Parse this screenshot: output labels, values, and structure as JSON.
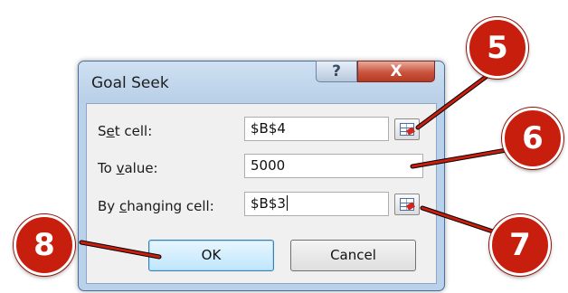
{
  "dialog": {
    "title": "Goal Seek",
    "help_glyph": "?",
    "close_glyph": "X"
  },
  "fields": {
    "set_cell": {
      "label_pre": "S",
      "label_accel": "e",
      "label_post": "t cell:",
      "value": "$B$4"
    },
    "to_value": {
      "label_pre": "To ",
      "label_accel": "v",
      "label_post": "alue:",
      "value": "5000"
    },
    "by_changing": {
      "label_pre": "By ",
      "label_accel": "c",
      "label_post": "hanging cell:",
      "value": "$B$3"
    }
  },
  "buttons": {
    "ok": "OK",
    "cancel": "Cancel"
  },
  "callouts": {
    "set_cell_ref": "5",
    "to_value_field": "6",
    "changing_cell_ref": "7",
    "ok_button": "8"
  },
  "colors": {
    "callout": "#c81e0e",
    "close_button": "#c9543d",
    "dialog_frame": "#b9d1ea"
  },
  "icons": {
    "help": "help-icon",
    "close": "close-icon",
    "range_select": "range-select-icon"
  }
}
